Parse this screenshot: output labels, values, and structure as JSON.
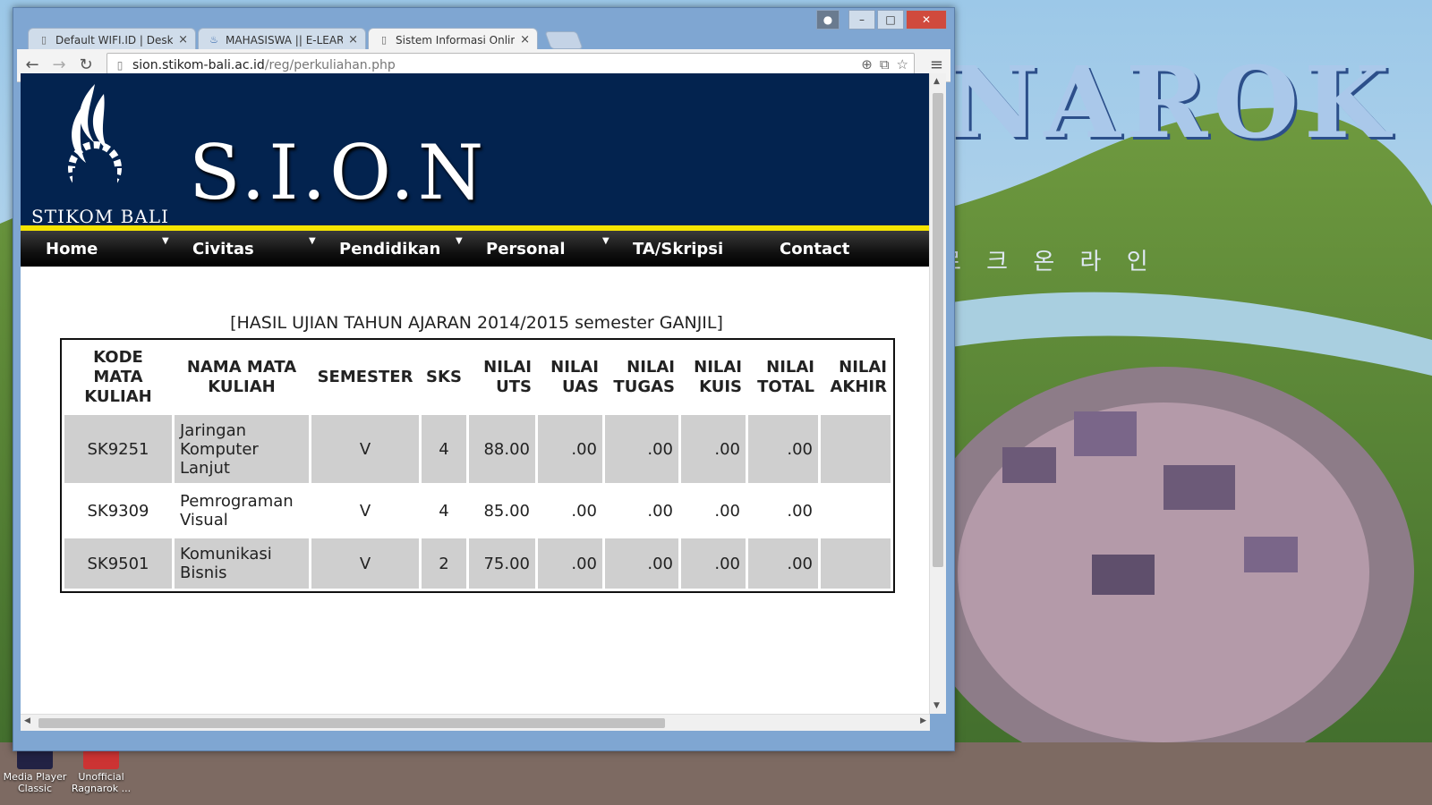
{
  "desktop": {
    "icons": [
      {
        "label": "Media Player Classic"
      },
      {
        "label": "Unofficial Ragnarok ..."
      }
    ],
    "wallpaper_text": "NAROK",
    "wallpaper_korean": "로 크 온 라 인"
  },
  "browser": {
    "tabs": [
      {
        "label": "Default WIFI.ID | Desktop",
        "icon": "page-icon",
        "active": false
      },
      {
        "label": "MAHASISWA || E-LEARNIN",
        "icon": "flame-icon",
        "active": false
      },
      {
        "label": "Sistem Informasi Online K",
        "icon": "page-icon",
        "active": true
      }
    ],
    "close_glyph": "×",
    "address": {
      "host": "sion.stikom-bali.ac.id",
      "path": "/reg/perkuliahan.php"
    }
  },
  "page": {
    "logo_text": "STIKOM BALI",
    "site_title": "S.I.O.N",
    "nav": [
      "Home",
      "Civitas",
      "Pendidikan",
      "Personal",
      "TA/Skripsi",
      "Contact"
    ],
    "heading": "[HASIL UJIAN TAHUN AJARAN 2014/2015 semester GANJIL]",
    "table": {
      "headers": [
        "KODE MATA KULIAH",
        "NAMA MATA KULIAH",
        "SEMESTER",
        "SKS",
        "NILAI UTS",
        "NILAI UAS",
        "NILAI TUGAS",
        "NILAI KUIS",
        "NILAI TOTAL",
        "NILAI AKHIR"
      ],
      "rows": [
        [
          "SK9251",
          "Jaringan Komputer Lanjut",
          "V",
          "4",
          "88.00",
          ".00",
          ".00",
          ".00",
          ".00",
          ""
        ],
        [
          "SK9309",
          "Pemrograman Visual",
          "V",
          "4",
          "85.00",
          ".00",
          ".00",
          ".00",
          ".00",
          ""
        ],
        [
          "SK9501",
          "Komunikasi Bisnis",
          "V",
          "2",
          "75.00",
          ".00",
          ".00",
          ".00",
          ".00",
          ""
        ]
      ]
    }
  },
  "colors": {
    "banner": "#03234f",
    "accent_line": "#f5e400",
    "row_shade": "#cfcfcf"
  }
}
